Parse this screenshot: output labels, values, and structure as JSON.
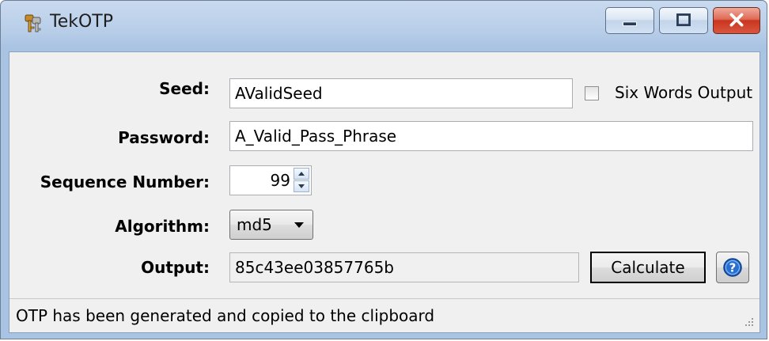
{
  "window": {
    "title": "TekOTP",
    "icon": "keys-icon",
    "controls": [
      "minimize-icon",
      "maximize-icon",
      "close-icon"
    ]
  },
  "form": {
    "seed": {
      "label": "Seed:",
      "value": "AValidSeed"
    },
    "six_words": {
      "label": "Six Words Output",
      "checked": false
    },
    "password": {
      "label": "Password:",
      "value": "A_Valid_Pass_Phrase"
    },
    "sequence": {
      "label": "Sequence Number:",
      "value": "99"
    },
    "algorithm": {
      "label": "Algorithm:",
      "value": "md5"
    },
    "output": {
      "label": "Output:",
      "value": "85c43ee03857765b"
    },
    "calculate_label": "Calculate",
    "help_icon": "help-icon"
  },
  "status": {
    "message": "OTP has been generated and copied to the clipboard"
  },
  "colors": {
    "frame": "#b7cde8",
    "close": "#c9351f",
    "help_accent": "#2a6fd0"
  }
}
